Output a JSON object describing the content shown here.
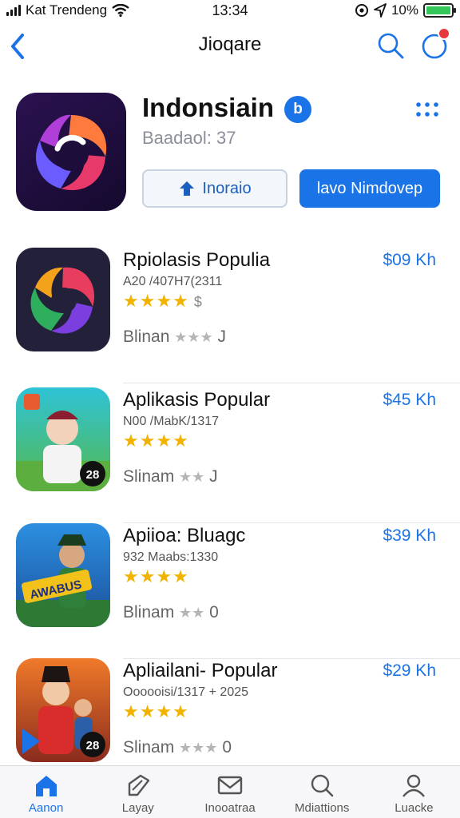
{
  "status_bar": {
    "carrier": "Kat Trendeng",
    "time": "13:34",
    "battery": "10%"
  },
  "nav": {
    "title": "Jioqare"
  },
  "hero": {
    "title": "Indonsiain",
    "badge": "b",
    "subtitle": "Baadaol: 37",
    "secondary_button": "Inoraio",
    "primary_button": "lavo Nimdovep"
  },
  "apps": [
    {
      "name": "Rpiolasis Populia",
      "meta": "A20 /407H7(2311",
      "stars": "★★★★",
      "stars_extra": "$",
      "status": "Blinan",
      "status_stars": "★★★",
      "status_suffix": "J",
      "price": "$09 Kh"
    },
    {
      "name": "Aplikasis Popular",
      "meta": "N00 /MabK/1317",
      "stars": "★★★★",
      "stars_extra": "",
      "status": "Slinam",
      "status_stars": "★★",
      "status_suffix": "J",
      "price": "$45 Kh"
    },
    {
      "name": "Apiioa: Bluagc",
      "meta": "932 Maabs:1330",
      "stars": "★★★★",
      "stars_extra": "",
      "status": "Blinam",
      "status_stars": "★★",
      "status_suffix": "0",
      "price": "$39 Kh"
    },
    {
      "name": "Apliailani- Popular",
      "meta": "Oooooisi/1317 + 2025",
      "stars": "★★★★",
      "stars_extra": "",
      "status": "Slinam",
      "status_stars": "★★★",
      "status_suffix": "0",
      "price": "$29 Kh"
    }
  ],
  "tabs": [
    {
      "label": "Aanon",
      "icon": "home-icon",
      "active": true
    },
    {
      "label": "Layay",
      "icon": "tag-icon",
      "active": false
    },
    {
      "label": "Inooatraa",
      "icon": "mail-icon",
      "active": false
    },
    {
      "label": "Mdiattions",
      "icon": "search-icon",
      "active": false
    },
    {
      "label": "Luacke",
      "icon": "profile-icon",
      "active": false
    }
  ],
  "colors": {
    "accent": "#1b73e8",
    "star": "#f2b300",
    "notification": "#e8383d",
    "battery": "#34c759"
  }
}
